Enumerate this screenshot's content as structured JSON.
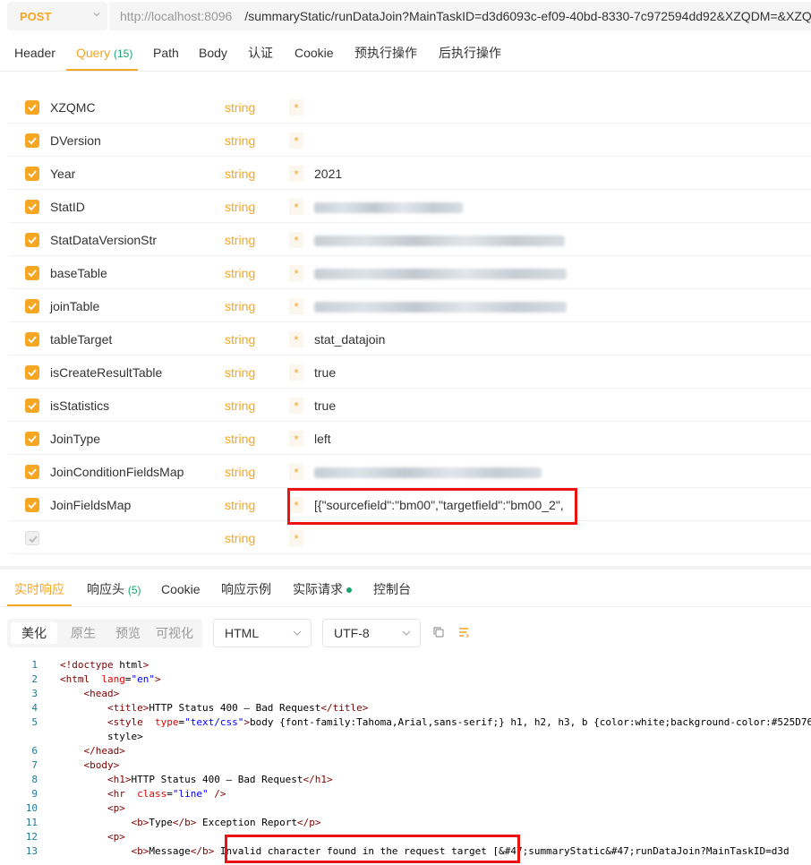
{
  "request": {
    "method": "POST",
    "url_host": "http://localhost:8096",
    "url_path": "/summaryStatic/runDataJoin?MainTaskID=d3d6093c-ef09-40bd-8330-7c972594dd92&XZQDM=&XZQ"
  },
  "tabs": [
    {
      "label": "Header"
    },
    {
      "label": "Query",
      "count": "(15)"
    },
    {
      "label": "Path"
    },
    {
      "label": "Body"
    },
    {
      "label": "认证"
    },
    {
      "label": "Cookie"
    },
    {
      "label": "预执行操作"
    },
    {
      "label": "后执行操作"
    }
  ],
  "params": {
    "type_label": "string",
    "required_mark": "*",
    "rows": [
      {
        "name": "XZQMC",
        "value": "",
        "checked": true
      },
      {
        "name": "DVersion",
        "value": "",
        "checked": true
      },
      {
        "name": "Year",
        "value": "2021",
        "checked": true
      },
      {
        "name": "StatID",
        "value": "",
        "checked": true,
        "blurred": true
      },
      {
        "name": "StatDataVersionStr",
        "value": "",
        "checked": true,
        "blurred": true
      },
      {
        "name": "baseTable",
        "value": "",
        "checked": true,
        "blurred": true
      },
      {
        "name": "joinTable",
        "value": "",
        "checked": true,
        "blurred": true
      },
      {
        "name": "tableTarget",
        "value": "stat_datajoin",
        "checked": true
      },
      {
        "name": "isCreateResultTable",
        "value": "true",
        "checked": true
      },
      {
        "name": "isStatistics",
        "value": "true",
        "checked": true
      },
      {
        "name": "JoinType",
        "value": "left",
        "checked": true
      },
      {
        "name": "JoinConditionFieldsMap",
        "value": "",
        "checked": true,
        "blurred": true
      },
      {
        "name": "JoinFieldsMap",
        "value": "[{\"sourcefield\":\"bm00\",\"targetfield\":\"bm00_2\",",
        "checked": true
      },
      {
        "name": "",
        "value": "",
        "checked": false
      }
    ]
  },
  "response_tabs": [
    {
      "label": "实时响应"
    },
    {
      "label": "响应头",
      "count": "(5)"
    },
    {
      "label": "Cookie"
    },
    {
      "label": "响应示例"
    },
    {
      "label": "实际请求"
    },
    {
      "label": "控制台"
    }
  ],
  "view_modes": [
    "美化",
    "原生",
    "预览",
    "可视化"
  ],
  "format_select": "HTML",
  "encoding_select": "UTF-8",
  "code_lines": [
    {
      "n": "1",
      "t": "<!doctype html>"
    },
    {
      "n": "2",
      "t": "<html  lang=\"en\">"
    },
    {
      "n": "3",
      "t": "    <head>"
    },
    {
      "n": "4",
      "t": "        <title>HTTP Status 400 – Bad Request</title>"
    },
    {
      "n": "5",
      "t": "        <style  type=\"text/css\">body {font-family:Tahoma,Arial,sans-serif;} h1, h2, h3, b {color:white;background-color:#525D76"
    },
    {
      "n": "",
      "t": "        style>"
    },
    {
      "n": "6",
      "t": "    </head>"
    },
    {
      "n": "7",
      "t": "    <body>"
    },
    {
      "n": "8",
      "t": "        <h1>HTTP Status 400 – Bad Request</h1>"
    },
    {
      "n": "9",
      "t": "        <hr  class=\"line\" />"
    },
    {
      "n": "10",
      "t": "        <p>"
    },
    {
      "n": "11",
      "t": "            <b>Type</b> Exception Report</p>"
    },
    {
      "n": "12",
      "t": "        <p>"
    },
    {
      "n": "13",
      "t": "            <b>Message</b> Invalid character found in the request target [&#47;summaryStatic&#47;runDataJoin?MainTaskID=d3d"
    }
  ]
}
